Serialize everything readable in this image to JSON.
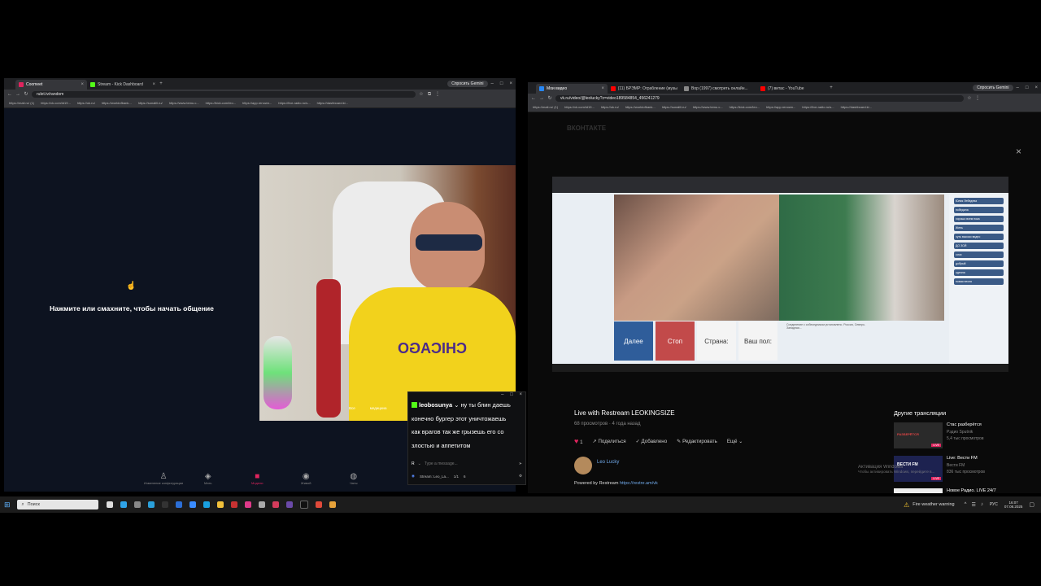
{
  "left_browser": {
    "tabs": [
      {
        "title": "Coomeet"
      },
      {
        "title": "Stream - Kick Dashboard"
      }
    ],
    "gemini_button": "Спросить Gemini",
    "url": "rulet.tv/random",
    "bookmarks": [
      "https://mail.ru/ (1)",
      "https://vk.com/id19...",
      "https://ok.ru/",
      "https://worldofbank...",
      "https://sonalili.ru/",
      "https://www.temu.c...",
      "https://kick.com/leo...",
      "https://app.renown...",
      "https://live-radio.ru/s...",
      "https://dashboard.ki..."
    ]
  },
  "roulette": {
    "prompt": "Нажмите или смахните, чтобы начать общение",
    "nav": [
      {
        "label": "Изменение конфигурации"
      },
      {
        "label": "Мать"
      },
      {
        "label": "Модели"
      },
      {
        "label": "Живой"
      },
      {
        "label": "Чаты"
      }
    ],
    "overlay_chips": [
      "Все",
      "медицина"
    ]
  },
  "kick_chat": {
    "username": "leobosunya",
    "message_lines": [
      "ну ты блин даешь",
      "конечно бургер этот уничтожаешь",
      "как врагов так же грызешь его со",
      "злостью и аппетитом"
    ],
    "input_placeholder": "Type a message...",
    "footer_user": "Stream: Leo_La...",
    "footer_count": "1/1",
    "footer_num": "6",
    "brand_color": "#53fc18"
  },
  "right_browser": {
    "tabs": [
      {
        "title": "Мои видео"
      },
      {
        "title": "(11) БРЭМР: Ограбление (музы..."
      },
      {
        "title": "Вор (1997) смотреть онлайн..."
      },
      {
        "title": "(7) витас - YouTube"
      }
    ],
    "gemini_button": "Спросить Gemini",
    "url": "vk.ru/video/@leolucky?z=video189584854_456241279",
    "bookmarks": [
      "https://mail.ru/ (1)",
      "https://vk.com/id19...",
      "https://ok.ru/",
      "https://worldofbank...",
      "https://sonalili.ru/",
      "https://www.temu.c...",
      "https://kick.com/leo...",
      "https://app.renown...",
      "https://live-radio.ru/s...",
      "https://dashboard.ki..."
    ]
  },
  "vk": {
    "logo": "ВКОНТАКТЕ",
    "inner_buttons": {
      "next": "Далее",
      "stop": "Стоп",
      "country": "Страна:",
      "gender": "Ваш пол:"
    },
    "inner_notice": "Соединение с собеседником установлено. Россия, Северо-Западная...",
    "chat_items": [
      "Юлия Лебедева",
      "победила",
      "хорошо всем пока",
      "Жень",
      "чуть высоко видно",
      "ДО ЗОЙ",
      "сочи",
      "добрый",
      "одеяла",
      "новая песня"
    ],
    "video_title": "Live with Restream LEOKINGSIZE",
    "views": "68 просмотров",
    "ago": "4 года назад",
    "likes": "1",
    "share": "Поделиться",
    "added": "Добавлено",
    "edit": "Редактировать",
    "more": "Ещё",
    "author": "Leo Lucky",
    "powered_label": "Powered by Restream",
    "powered_link": "https://restre.am/vk",
    "side_title": "Другие трансляции",
    "side": [
      {
        "title": "Стас разберётся",
        "channel": "Рэдио Sputnik",
        "meta": "5,4 тыс просмотров",
        "thumb_text": "РАЗБЕРЁТСЯ"
      },
      {
        "title": "Live: Вести FM",
        "channel": "Вести FM",
        "meta": "836 тыс просмотров",
        "thumb_text": "ВЕСТИ FM"
      },
      {
        "title": "Новое Радио. LIVE 24/7",
        "channel": "",
        "meta": "",
        "thumb_text": ""
      }
    ],
    "live_badge": "LIVE",
    "activation_line1": "Активация Windows",
    "activation_line2": "Чтобы активировать Windows, перейдите в..."
  },
  "taskbar": {
    "search": "Поиск",
    "weather": "Fire weather warning",
    "lang": "РУС",
    "time": "16:07",
    "date": "07.08.2025"
  }
}
